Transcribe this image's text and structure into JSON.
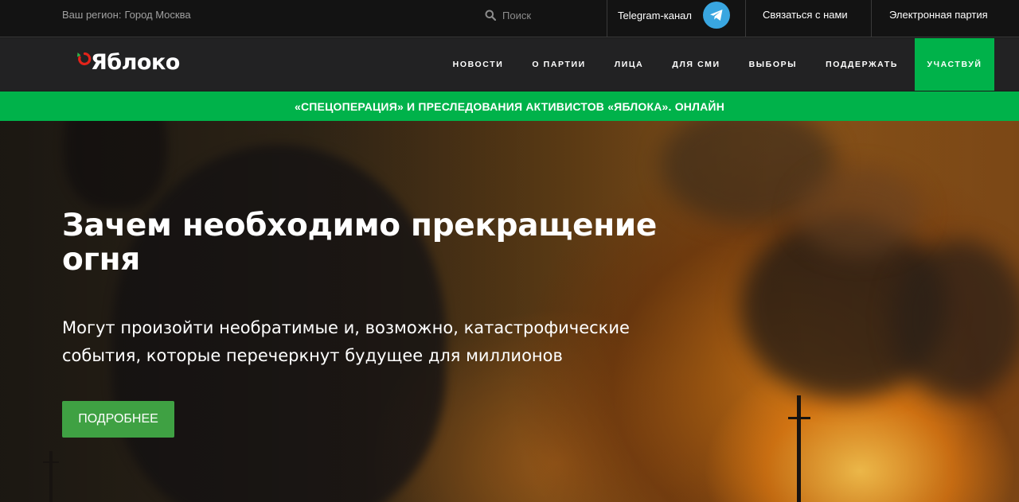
{
  "topbar": {
    "region_label": "Ваш регион:",
    "region_name": "Город Москва",
    "search_placeholder": "Поиск",
    "telegram_label": "Telegram-канал",
    "contact_label": "Связаться с нами",
    "e_party_label": "Электронная партия"
  },
  "logo": {
    "text": "Яблоко"
  },
  "nav": {
    "items": [
      {
        "label": "НОВОСТИ"
      },
      {
        "label": "О ПАРТИИ"
      },
      {
        "label": "ЛИЦА"
      },
      {
        "label": "ДЛЯ СМИ"
      },
      {
        "label": "ВЫБОРЫ"
      },
      {
        "label": "ПОДДЕРЖАТЬ"
      }
    ],
    "cta_label": "УЧАСТВУЙ"
  },
  "announcement": {
    "text": "«СПЕЦОПЕРАЦИЯ» И ПРЕСЛЕДОВАНИЯ АКТИВИСТОВ «ЯБЛОКА». ОНЛАЙН"
  },
  "hero": {
    "title": "Зачем необходимо прекращение огня",
    "subtitle": "Могут произойти необратимые и, возможно, катастрофические события, которые перечеркнут будущее для миллионов",
    "button_label": "ПОДРОБНЕЕ"
  },
  "colors": {
    "brand_green": "#00b24a",
    "button_green": "#3fa143",
    "telegram_blue": "#39a6e0",
    "logo_red": "#e2231a",
    "topbar_bg": "#131313",
    "navbar_bg": "#222223"
  },
  "icons": {
    "search": "search-icon",
    "telegram": "telegram-icon",
    "logo_mark": "apple-ring-icon"
  }
}
